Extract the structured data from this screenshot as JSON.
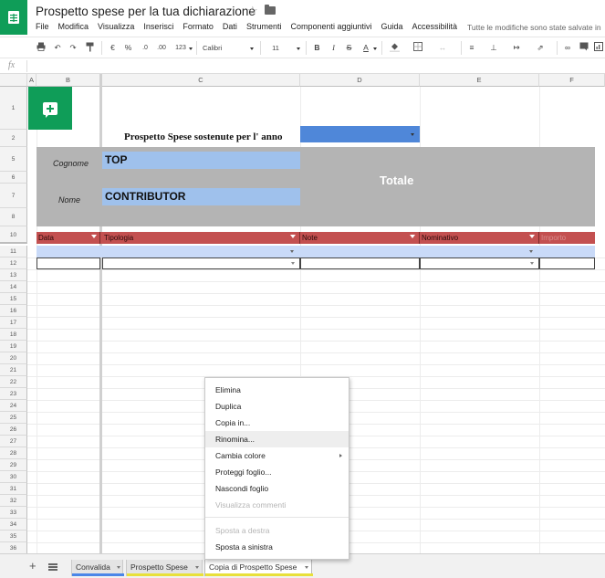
{
  "window": {
    "doc_title": "Prospetto spese per la tua dichiarazione",
    "saved_status": "Tutte le modifiche sono state salvate in"
  },
  "menubar": [
    "File",
    "Modifica",
    "Visualizza",
    "Inserisci",
    "Formato",
    "Dati",
    "Strumenti",
    "Componenti aggiuntivi",
    "Guida",
    "Accessibilità"
  ],
  "toolbar": {
    "currency": "€",
    "percent": "%",
    "dec_less": ".0",
    "dec_more": ".00",
    "number_format": "123",
    "font": "Calibri",
    "font_size": "11",
    "bold": "B",
    "italic": "I",
    "strike": "S",
    "text_color": "A"
  },
  "formula_bar": {
    "fx_label": "fx"
  },
  "grid": {
    "columns": [
      "A",
      "B",
      "C",
      "D",
      "E",
      "F"
    ],
    "rows": [
      "1",
      "2",
      "5",
      "6",
      "7",
      "8",
      "10",
      "11",
      "12",
      "13",
      "14",
      "15",
      "16",
      "17",
      "18",
      "19",
      "20",
      "21",
      "22",
      "23",
      "24",
      "25",
      "26",
      "27",
      "28",
      "29",
      "30",
      "31",
      "32",
      "33",
      "34",
      "35",
      "36"
    ]
  },
  "sheet": {
    "year_label": "Prospetto Spese sostenute per l' anno",
    "cognome_label": "Cognome",
    "cognome_value": "TOP",
    "nome_label": "Nome",
    "nome_value": "CONTRIBUTOR",
    "totale_label": "Totale",
    "table_headers": [
      "Data",
      "Tipologia",
      "Note",
      "Nominativo",
      "Importo"
    ]
  },
  "tabs": [
    {
      "label": "Convalida",
      "underline": "#4a86e8"
    },
    {
      "label": "Prospetto Spese",
      "underline": "#e8e03a"
    },
    {
      "label": "Copia di Prospetto Spese",
      "underline": "#e8e03a",
      "active": true
    }
  ],
  "context_menu": {
    "items": [
      {
        "label": "Elimina",
        "enabled": true
      },
      {
        "label": "Duplica",
        "enabled": true
      },
      {
        "label": "Copia in...",
        "enabled": true
      },
      {
        "label": "Rinomina...",
        "enabled": true,
        "highlighted": true
      },
      {
        "label": "Cambia colore",
        "enabled": true,
        "submenu": true
      },
      {
        "label": "Proteggi foglio...",
        "enabled": true
      },
      {
        "label": "Nascondi foglio",
        "enabled": true
      },
      {
        "label": "Visualizza commenti",
        "enabled": false
      },
      {
        "label": "Sposta a destra",
        "enabled": false
      },
      {
        "label": "Sposta a sinistra",
        "enabled": true
      }
    ]
  },
  "colors": {
    "brand_green": "#0f9d58",
    "header_red": "#c35050",
    "field_blue": "#9fc1ec",
    "select_blue": "#4f87d9",
    "block_gray": "#b4b4b4"
  }
}
